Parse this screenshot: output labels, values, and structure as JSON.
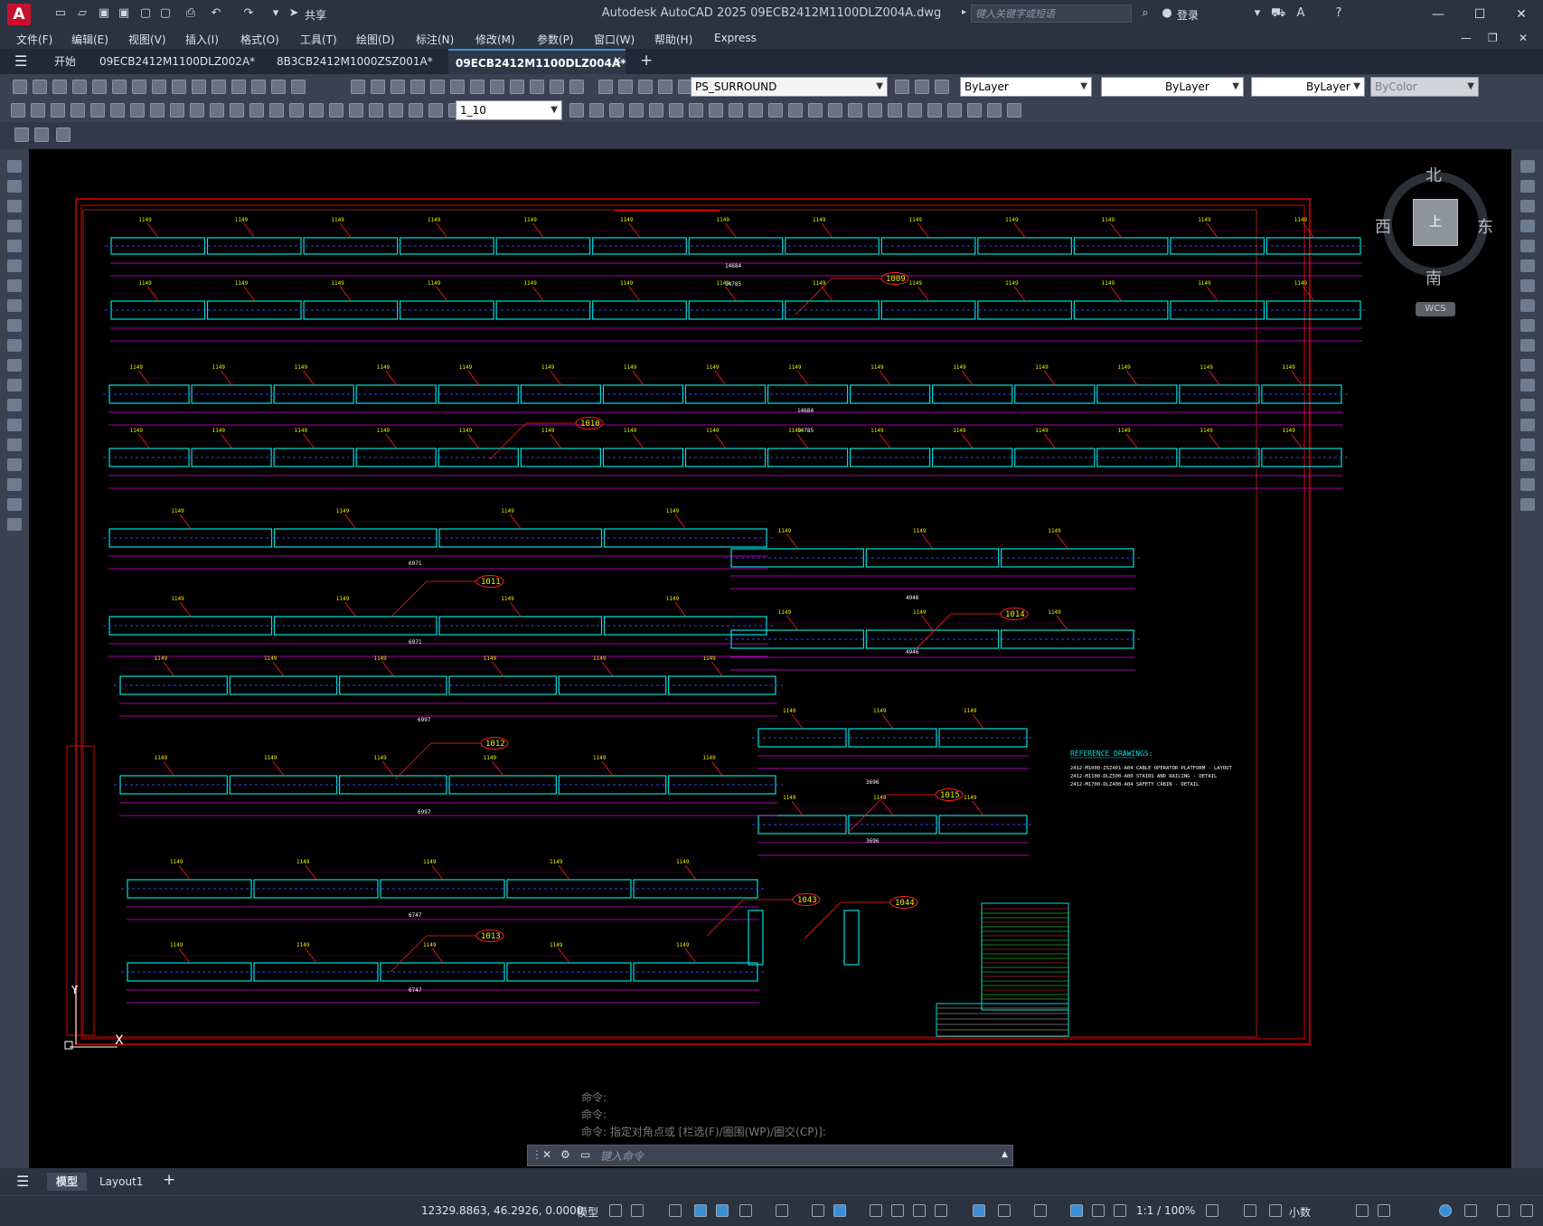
{
  "window": {
    "title": "Autodesk AutoCAD 2025    09ECB2412M1100DLZ004A.dwg",
    "share_label": "共享",
    "search_placeholder": "键入关键字或短语",
    "login_label": "登录"
  },
  "menu": [
    "文件(F)",
    "编辑(E)",
    "视图(V)",
    "插入(I)",
    "格式(O)",
    "工具(T)",
    "绘图(D)",
    "标注(N)",
    "修改(M)",
    "参数(P)",
    "窗口(W)",
    "帮助(H)",
    "Express"
  ],
  "doc_tabs": [
    "开始",
    "09ECB2412M1100DLZ002A*",
    "8B3CB2412M1000ZSZ001A*",
    "09ECB2412M1100DLZ004A*"
  ],
  "toolbar": {
    "layer_name": "PS_SURROUND",
    "color": "ByLayer",
    "linetype": "ByLayer",
    "lineweight": "ByLayer",
    "plotstyle": "ByColor",
    "scale": "1_10"
  },
  "viewcube": {
    "north": "北",
    "south": "南",
    "east": "东",
    "west": "西",
    "top": "上",
    "ucs": "WCS"
  },
  "drawing": {
    "callouts": [
      "1009",
      "1010",
      "1011",
      "1012",
      "1013",
      "1014",
      "1015",
      "1043",
      "1044"
    ],
    "reference_title": "REFERENCE DRAWINGS:",
    "reference_lines": [
      "2412-M1000-ZSZ401-A04   CABLE OPERATOR PLATFORM - LAYOUT",
      "2412-M1100-DLZ500-A00   STAIRS AND RAILING - DETAIL",
      "2412-M1700-DLZ400-A04   SAFETY CABIN - DETAIL"
    ],
    "marks": {
      "m1149": "1149",
      "m14785": "14785",
      "m14684": "14684",
      "m6971": "6971",
      "m6997": "6997",
      "m6747": "6747",
      "m4946": "4946",
      "m3696": "3696"
    }
  },
  "command_line": {
    "history": [
      "命令:",
      "命令:",
      "命令: 指定对角点或 [栏选(F)/圈围(WP)/圈交(CP)]:"
    ],
    "placeholder": "键入命令"
  },
  "layout_tabs": [
    "模型",
    "Layout1"
  ],
  "status": {
    "coords": "12329.8863, 46.2926, 0.0000",
    "model": "模型",
    "scale": "1:1 / 100%",
    "units": "小数"
  }
}
